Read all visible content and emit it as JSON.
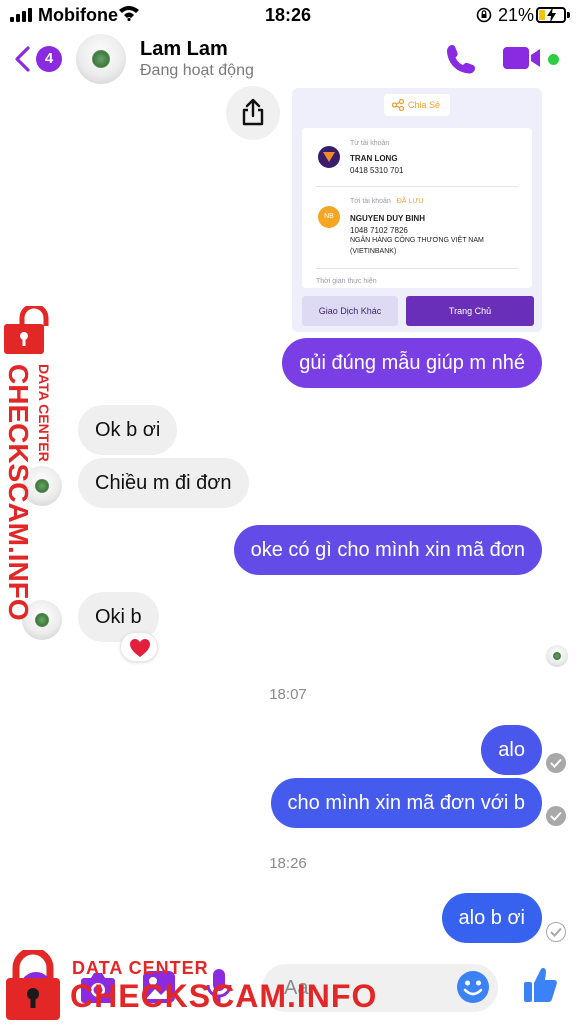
{
  "status_bar": {
    "carrier": "Mobifone",
    "time": "18:26",
    "battery_pct": "21%"
  },
  "header": {
    "back_count": "4",
    "name": "Lam Lam",
    "status": "Đang hoạt động"
  },
  "receipt": {
    "share_label": "Chia Sẻ",
    "from_label": "Từ tài khoản",
    "from_name": "TRAN LONG",
    "from_account": "0418 5310 701",
    "to_label": "Tới tài khoản",
    "saved_label": "ĐÃ LƯU",
    "to_avatar": "NB",
    "to_name": "NGUYEN DUY BINH",
    "to_account": "1048 7102 7826",
    "bank_line1": "NGÂN HÀNG CÔNG THƯƠNG VIỆT NAM",
    "bank_line2": "(VIETINBANK)",
    "time_label": "Thời gian thực hiện",
    "btn_other": "Giao Dịch Khác",
    "btn_home": "Trang Chủ"
  },
  "messages": [
    {
      "dir": "out",
      "text": "gủi đúng mẫu giúp m nhé"
    },
    {
      "dir": "in",
      "text": "Ok b ơi"
    },
    {
      "dir": "in",
      "text": "Chiều m đi đơn"
    },
    {
      "dir": "out",
      "text": "oke có gì cho mình xin mã đơn"
    },
    {
      "dir": "in",
      "text": "Oki b",
      "reaction": "heart"
    },
    {
      "dir": "out",
      "text": "alo"
    },
    {
      "dir": "out",
      "text": "cho mình xin mã đơn với b"
    },
    {
      "dir": "out",
      "text": "alo b ơi"
    }
  ],
  "timestamps": [
    "18:07",
    "18:26"
  ],
  "composer": {
    "placeholder": "Aa"
  },
  "watermark": {
    "small": "DATA CENTER",
    "big": "CHECKSCAM.INFO"
  },
  "colors": {
    "accent": "#8a2be2",
    "bubble_top": "#7b3fe4",
    "bubble_bottom": "#3164f0",
    "watermark": "#e32626"
  },
  "icons": [
    "back-chevron-icon",
    "phone-icon",
    "video-icon",
    "share-icon",
    "camera-icon",
    "gallery-icon",
    "mic-icon",
    "emoji-icon",
    "like-icon",
    "lock-icon"
  ]
}
